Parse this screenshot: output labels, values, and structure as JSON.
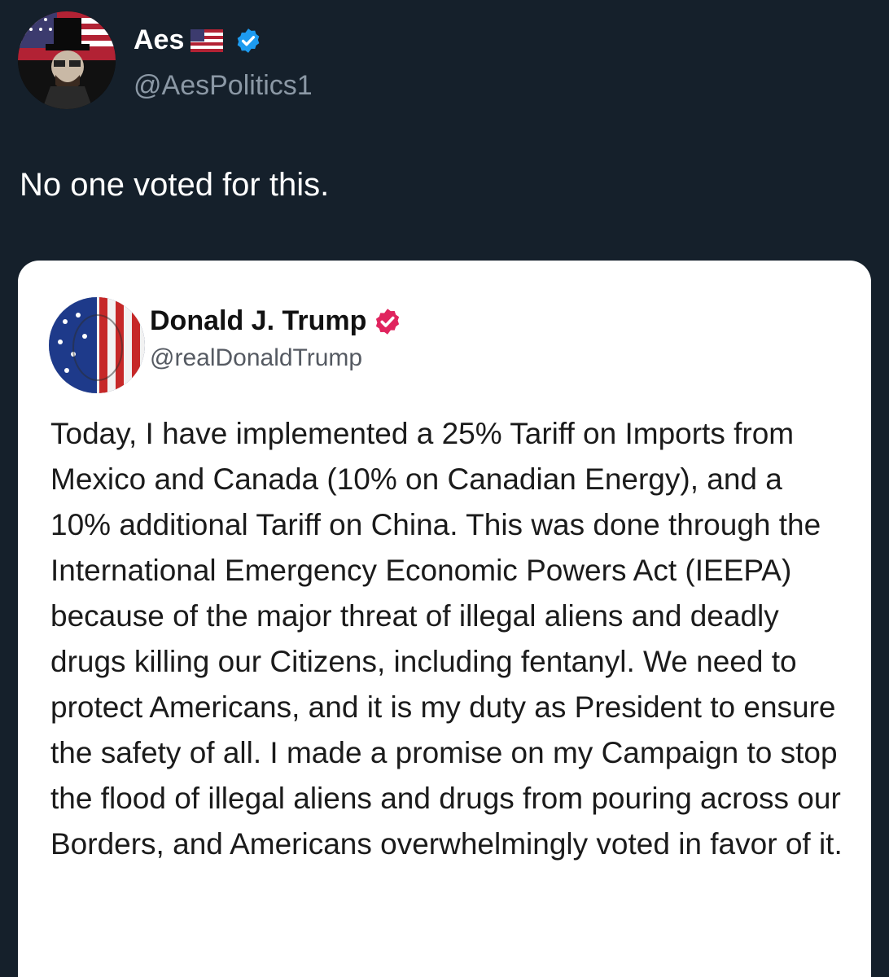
{
  "post": {
    "author": {
      "name": "Aes",
      "handle": "@AesPolitics1",
      "flag_icon": "us-flag-icon",
      "badge_icon": "verified-badge-icon",
      "badge_color": "#1d9bf0"
    },
    "text": "No one voted for this."
  },
  "quoted_post": {
    "author": {
      "name": "Donald J. Trump",
      "handle": "@realDonaldTrump",
      "badge_icon": "verified-badge-icon",
      "badge_color": "#e0245e"
    },
    "body": "Today, I have implemented a 25% Tariff on Imports from Mexico and Canada (10% on Canadian Energy), and a 10% additional Tariff on China. This was done through the International Emergency Economic Powers Act (IEEPA) because of the major threat of illegal aliens and deadly drugs killing our Citizens, including fentanyl. We need to protect Americans, and it is my duty as President to ensure the safety of all. I made a promise on my Campaign to stop the flood of illegal aliens and drugs from pouring across our Borders, and Americans overwhelmingly voted in favor of it."
  },
  "colors": {
    "background": "#15202b",
    "card": "#ffffff",
    "secondary_text": "#8b98a5"
  }
}
